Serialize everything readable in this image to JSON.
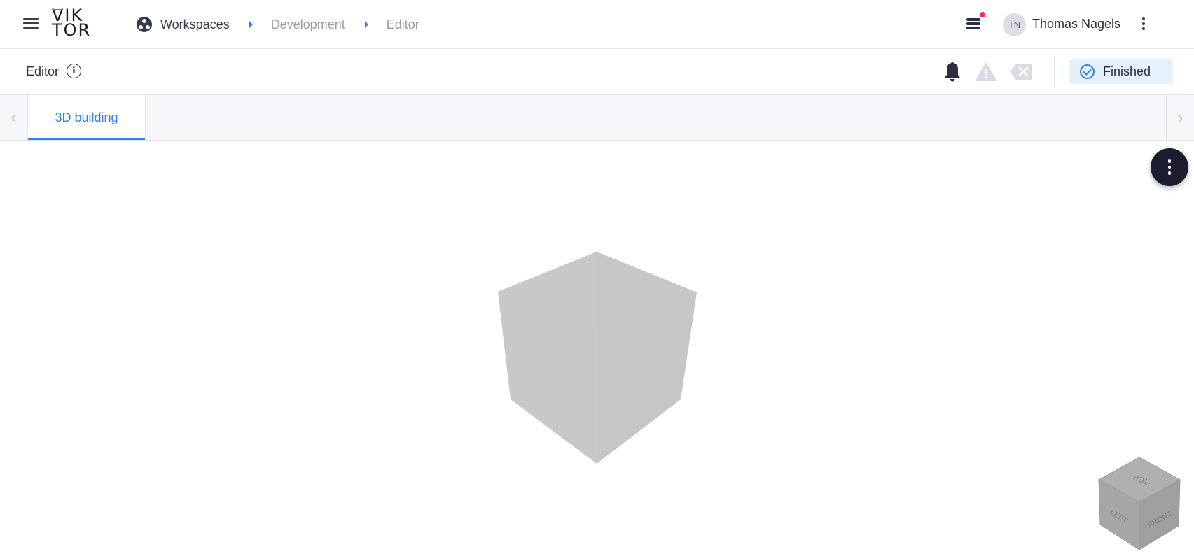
{
  "header": {
    "logo_line1": "VIK",
    "logo_line2": "TOR",
    "breadcrumbs": [
      "Workspaces",
      "Development",
      "Editor"
    ],
    "user_initials": "TN",
    "user_name": "Thomas Nagels"
  },
  "editor_bar": {
    "title": "Editor",
    "info_icon": "i",
    "status": "Finished"
  },
  "tabs": [
    {
      "label": "3D building",
      "active": true
    }
  ],
  "viewer": {
    "navcube_faces": {
      "top": "TOP",
      "left": "LEFT",
      "front": "FRONT"
    }
  },
  "colors": {
    "accent": "#2f80ed",
    "status_bg": "#e5f1fd",
    "notification_dot": "#f0304f",
    "model": "#c8c8c8"
  }
}
